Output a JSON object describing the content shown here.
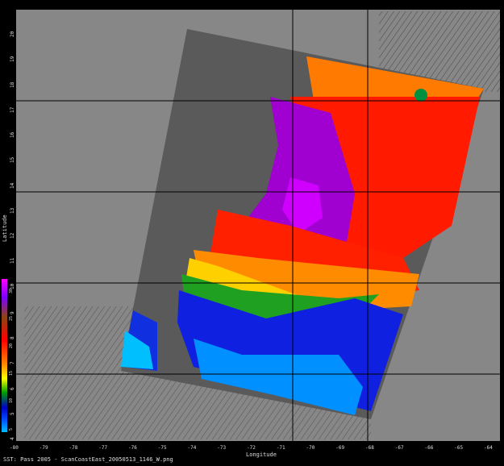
{
  "map": {
    "x_axis_title": "Longitude",
    "y_axis_title": "Latitude",
    "caption": "SST: Pass 2005 - ScanCoastEast_20050513_1146_W.png",
    "colors": {
      "background": "#000000",
      "land_mask": "#5a5a5a",
      "no_data": "#878787",
      "gridline": "#000000"
    },
    "colorbar_stops": [
      "#00bfff",
      "#0050ff",
      "#0000c8",
      "#00a000",
      "#ffff00",
      "#ff8000",
      "#ff0000",
      "#8b4513",
      "#8000ff",
      "#ff00ff"
    ],
    "y_ticks": [
      "4",
      "5",
      "6",
      "7",
      "8",
      "9",
      "10",
      "11",
      "12",
      "13",
      "14",
      "15",
      "16",
      "17",
      "18",
      "19",
      "20"
    ],
    "x_ticks": [
      "-80",
      "-79",
      "-78",
      "-77",
      "-76",
      "-75",
      "-74",
      "-73",
      "-72",
      "-71",
      "-70",
      "-69",
      "-68",
      "-67",
      "-66",
      "-65",
      "-64"
    ],
    "colorbar_ticks": [
      "5",
      "10",
      "15",
      "20",
      "25",
      "30"
    ]
  }
}
